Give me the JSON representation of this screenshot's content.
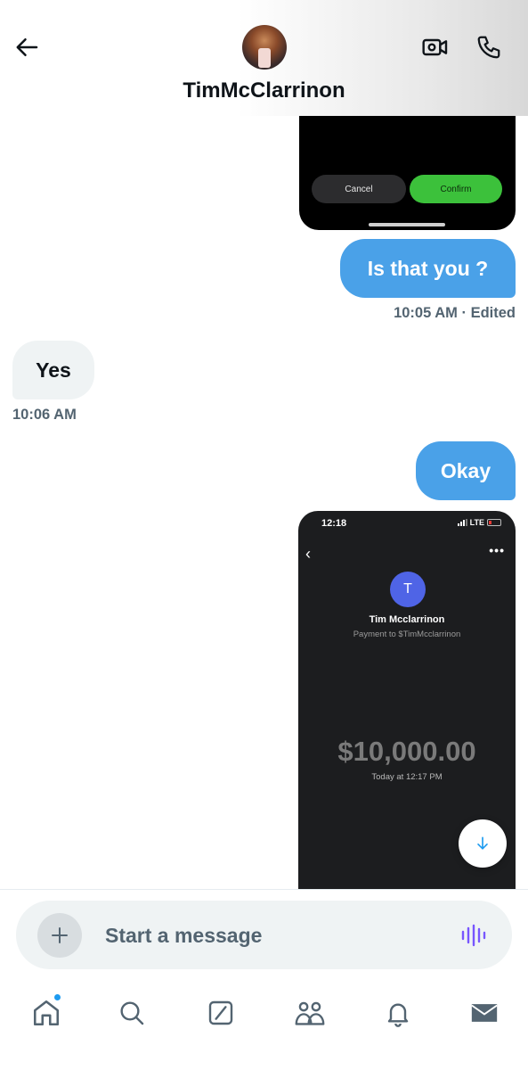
{
  "header": {
    "contact_name": "TimMcClarrinon",
    "back_icon": "arrow-left-icon",
    "video_icon": "video-camera-icon",
    "call_icon": "phone-icon"
  },
  "messages": {
    "screenshot_1": {
      "cancel_label": "Cancel",
      "confirm_label": "Confirm"
    },
    "msg_is_that_you": "Is that you ?",
    "meta_is_that_you": "10:05 AM · Edited",
    "msg_yes": "Yes",
    "meta_yes": "10:06 AM",
    "msg_okay": "Okay",
    "screenshot_2": {
      "status_time": "12:18",
      "network": "LTE",
      "more": "•••",
      "avatar_letter": "T",
      "name": "Tim Mcclarrinon",
      "subtitle": "Payment to $TimMcclarrinon",
      "amount": "$10,000.00",
      "date": "Today at 12:17 PM"
    }
  },
  "composer": {
    "placeholder": "Start a message"
  },
  "nav": {
    "items": [
      "home-icon",
      "search-icon",
      "grok-icon",
      "communities-icon",
      "notifications-icon",
      "messages-icon"
    ]
  },
  "colors": {
    "my_bubble": "#4aa1e8",
    "their_bubble": "#eff3f4",
    "accent": "#1d9bf0",
    "voice": "#7856ff"
  }
}
